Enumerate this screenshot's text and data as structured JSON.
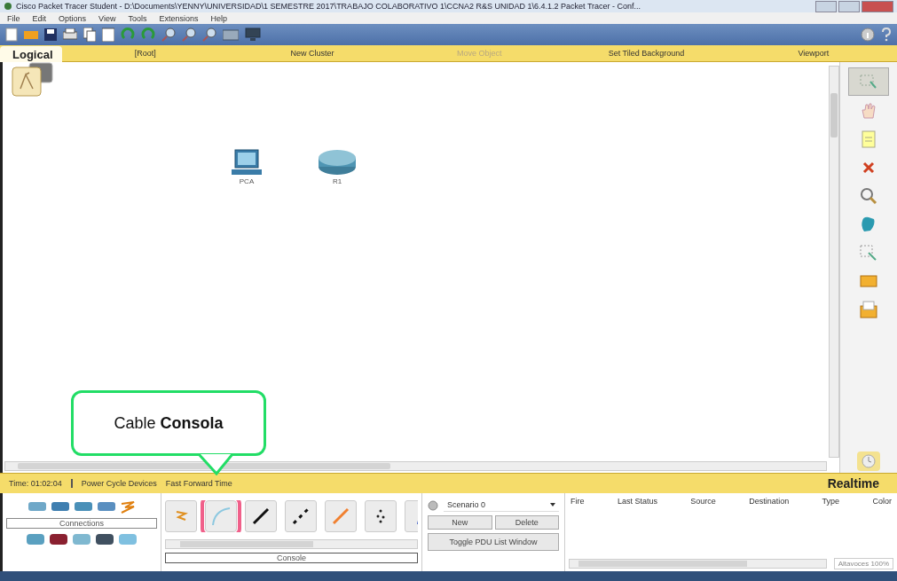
{
  "window": {
    "title": "Cisco Packet Tracer Student - D:\\Documents\\YENNY\\UNIVERSIDAD\\1 SEMESTRE 2017\\TRABAJO COLABORATIVO 1\\CCNA2 R&S UNIDAD 1\\6.4.1.2 Packet Tracer - Conf..."
  },
  "menu": [
    "File",
    "Edit",
    "Options",
    "View",
    "Tools",
    "Extensions",
    "Help"
  ],
  "nav": [
    {
      "label": "Logical",
      "kind": "mode"
    },
    {
      "label": "[Root]",
      "kind": "link",
      "disabled": false
    },
    {
      "label": "New Cluster",
      "kind": "link",
      "disabled": false
    },
    {
      "label": "Move Object",
      "kind": "link",
      "disabled": true
    },
    {
      "label": "Set Tiled Background",
      "kind": "link",
      "disabled": false
    },
    {
      "label": "Viewport",
      "kind": "link",
      "disabled": false
    }
  ],
  "devices": [
    {
      "label": "PCA",
      "kind": "pc"
    },
    {
      "label": "R1",
      "kind": "router"
    }
  ],
  "tools": [
    {
      "kind": "select",
      "selected": true
    },
    {
      "kind": "move",
      "selected": false
    },
    {
      "kind": "note",
      "selected": false
    },
    {
      "kind": "delete",
      "selected": false
    },
    {
      "kind": "inspect",
      "selected": false
    },
    {
      "kind": "shape",
      "selected": false
    },
    {
      "kind": "resize",
      "selected": false
    },
    {
      "kind": "pdu",
      "selected": false
    },
    {
      "kind": "complex-pdu",
      "selected": false
    }
  ],
  "status_bar": {
    "time": "Time: 01:02:04",
    "power": "Power Cycle Devices",
    "fast_forward": "Fast Forward Time",
    "mode": "Realtime"
  },
  "device_panel": {
    "label": "Connections",
    "cable_label": "Console"
  },
  "cables": [
    {
      "kind": "auto",
      "selected": false
    },
    {
      "kind": "console",
      "selected": true
    },
    {
      "kind": "straight",
      "selected": false
    },
    {
      "kind": "crossover",
      "selected": false
    },
    {
      "kind": "fiber",
      "selected": false
    },
    {
      "kind": "phone",
      "selected": false
    },
    {
      "kind": "coaxial",
      "selected": false
    }
  ],
  "scenario": {
    "value": "Scenario 0",
    "buttons": [
      "New",
      "Delete"
    ],
    "toggle": "Toggle PDU List Window"
  },
  "pdu_table": {
    "columns": [
      "Fire",
      "Last Status",
      "Source",
      "Destination",
      "Type",
      "Color"
    ]
  },
  "zoom_label": "Altavoces 100%",
  "callout": {
    "text": "Cable **Consola**"
  }
}
